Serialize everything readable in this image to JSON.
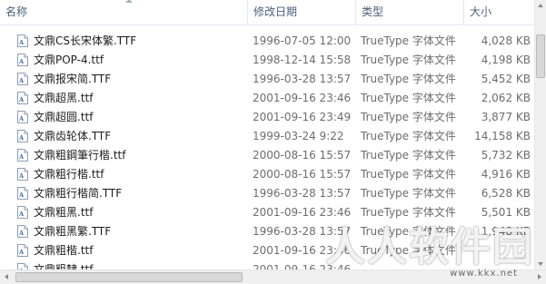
{
  "columns": {
    "name": "名称",
    "date": "修改日期",
    "type": "类型",
    "size": "大小"
  },
  "files": [
    {
      "name": "文鼎CS长宋体繁.TTF",
      "date": "1996-07-05 12:00",
      "type": "TrueType 字体文件",
      "size": "4,028 KB"
    },
    {
      "name": "文鼎POP-4.ttf",
      "date": "1998-12-14 15:58",
      "type": "TrueType 字体文件",
      "size": "4,198 KB"
    },
    {
      "name": "文鼎报宋简.TTF",
      "date": "1996-03-28 13:57",
      "type": "TrueType 字体文件",
      "size": "5,452 KB"
    },
    {
      "name": "文鼎超黑.ttf",
      "date": "2001-09-16 23:46",
      "type": "TrueType 字体文件",
      "size": "2,062 KB"
    },
    {
      "name": "文鼎超圆.ttf",
      "date": "2001-09-16 23:49",
      "type": "TrueType 字体文件",
      "size": "3,877 KB"
    },
    {
      "name": "文鼎齿轮体.TTF",
      "date": "1999-03-24 9:22",
      "type": "TrueType 字体文件",
      "size": "14,158 KB"
    },
    {
      "name": "文鼎粗鋼筆行楷.ttf",
      "date": "2000-08-16 15:57",
      "type": "TrueType 字体文件",
      "size": "5,732 KB"
    },
    {
      "name": "文鼎粗行楷.ttf",
      "date": "2000-08-16 15:57",
      "type": "TrueType 字体文件",
      "size": "4,916 KB"
    },
    {
      "name": "文鼎粗行楷简.TTF",
      "date": "1996-03-28 13:57",
      "type": "TrueType 字体文件",
      "size": "6,528 KB"
    },
    {
      "name": "文鼎粗黑.ttf",
      "date": "2001-09-16 23:46",
      "type": "TrueType 字体文件",
      "size": "5,501 KB"
    },
    {
      "name": "文鼎粗黑繁.TTF",
      "date": "1996-03-28 13:57",
      "type": "TrueType 字体文件",
      "size": "1,948 KB"
    },
    {
      "name": "文鼎粗楷.ttf",
      "date": "2001-09-16 23:46",
      "type": "TrueType 字体文件",
      "size": ""
    },
    {
      "name": "文鼎粗隸.ttf",
      "date": "2001-09-16 23:46",
      "type": "",
      "size": ""
    }
  ],
  "file_icon": "font-file-icon",
  "watermark": {
    "text": "人人软件园",
    "url": "www.kkx.net"
  }
}
